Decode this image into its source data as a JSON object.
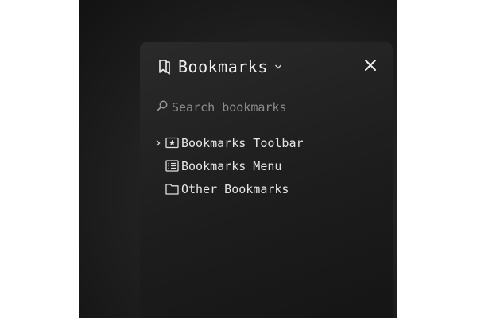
{
  "sidebar": {
    "title": "Bookmarks",
    "search": {
      "placeholder": "Search bookmarks",
      "value": ""
    },
    "items": [
      {
        "label": "Bookmarks Toolbar",
        "icon": "star-folder-icon",
        "expandable": true
      },
      {
        "label": "Bookmarks Menu",
        "icon": "list-icon",
        "expandable": false
      },
      {
        "label": "Other Bookmarks",
        "icon": "folder-icon",
        "expandable": false
      }
    ]
  },
  "colors": {
    "panel_background": "#1d1d1d",
    "window_background": "#121212",
    "text": "#e6e6e6",
    "placeholder": "#8c8c8c"
  }
}
